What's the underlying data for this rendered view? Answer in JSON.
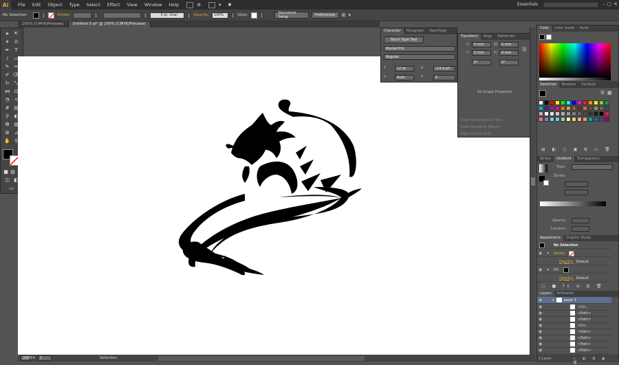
{
  "app": {
    "logo": "Ai",
    "essentials": "Essentials"
  },
  "menu": [
    "File",
    "Edit",
    "Object",
    "Type",
    "Select",
    "Effect",
    "View",
    "Window",
    "Help"
  ],
  "control": {
    "selection": "No Selection",
    "stroke_label": "Stroke:",
    "brush": "3 pt. Oval",
    "opacity_label": "Opacity:",
    "opacity_value": "100%",
    "style_label": "Style:",
    "doc_setup": "Document Setup",
    "preferences": "Preferences"
  },
  "tabs": [
    "150% (CMYK/Preview)",
    "Untitled-3.ai* @ 200% (CMYK/Preview)"
  ],
  "character": {
    "tabs": [
      "Character",
      "Paragraph",
      "OpenType"
    ],
    "touch_type": "Touch Type Tool",
    "font": "Myriad Pro",
    "style": "Regular",
    "size": "12 pt",
    "leading": "(14,4 pt)",
    "kerning": "Auto",
    "tracking": "0"
  },
  "transform": {
    "tabs": [
      "Transform",
      "Align",
      "Pathfinder"
    ],
    "x_label": "X:",
    "y_label": "Y:",
    "w_label": "W:",
    "h_label": "H:",
    "x": "0 mm",
    "y": "0 mm",
    "w": "0 mm",
    "h": "0 mm",
    "rot": "0°",
    "shear": "0°",
    "no_shape": "No Shape Properties",
    "opt1": "Scale Rectangle Corners",
    "opt2": "Scale Strokes & Effects",
    "opt3": "Align to Pixel Grid"
  },
  "color_panel": {
    "tabs": [
      "Color",
      "Color Guide",
      "Kuler"
    ]
  },
  "swatches": {
    "tabs": [
      "Swatches",
      "Brushes",
      "Symbols"
    ]
  },
  "gradient": {
    "tabs": [
      "Stroke",
      "Gradient",
      "Transparency"
    ],
    "type_label": "Type:",
    "stroke_label": "Stroke:",
    "opacity_label": "Opacity:",
    "location_label": "Location:"
  },
  "appearance": {
    "tabs": [
      "Appearance",
      "Graphic Styles"
    ],
    "header": "No Selection",
    "stroke": "Stroke:",
    "opacity": "Opacity:",
    "default": "Default",
    "fill": "Fill:",
    "opacity2": "Opacity:",
    "default2": "Default"
  },
  "layers": {
    "tabs": [
      "Layers",
      "Artboards"
    ],
    "layer": "Layer 1",
    "items": [
      "<Co...",
      "<Path>",
      "<Path>",
      "<Co...",
      "<Path>",
      "<Path>",
      "<Path>",
      "<Path>"
    ],
    "count": "1 Layer"
  },
  "status": {
    "zoom": "200%",
    "page": "1",
    "tool": "Selection"
  },
  "colors": {
    "accent": "#e8a43a",
    "fill": "#000000"
  },
  "swatch_colors": [
    "#ffffff",
    "#000000",
    "#ff0000",
    "#ffff00",
    "#00ff00",
    "#00ffff",
    "#0000ff",
    "#ff00ff",
    "#ed1c24",
    "#f7941d",
    "#fff200",
    "#8dc63f",
    "#00a651",
    "#00aeef",
    "#2e3192",
    "#92278f",
    "#ec008c",
    "#f26522",
    "#c69c6d",
    "#8c6239",
    "#603913",
    "#a67c52",
    "#754c24",
    "#998675",
    "#736357",
    "#534741",
    "#c7b299",
    "#ffffff",
    "#e6e6e6",
    "#cccccc",
    "#b3b3b3",
    "#999999",
    "#808080",
    "#666666",
    "#4d4d4d",
    "#333333",
    "#1a1a1a",
    "#000000",
    "#ed145b",
    "#f06eaa",
    "#8781bd",
    "#6dcff6",
    "#7accc8",
    "#a3d39c",
    "#fff799",
    "#fdc689",
    "#f9ad81",
    "#f69679",
    "#00a99d",
    "#0072bc",
    "#662d91",
    "#9e005d"
  ]
}
